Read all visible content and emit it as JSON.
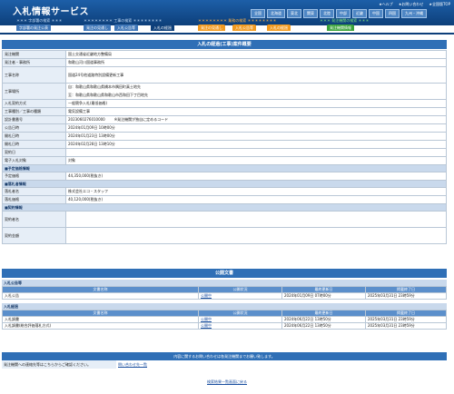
{
  "header": {
    "title": "入札情報サービス",
    "links": [
      "★ヘルプ",
      "★お問い合わせ",
      "★全国版TOP"
    ],
    "regions": [
      "全国",
      "北海道",
      "東北",
      "関東",
      "北陸",
      "中部",
      "近畿",
      "中国",
      "四国",
      "九州・沖縄"
    ]
  },
  "tab_groups": [
    "＊＊＊ 字部署の検索 ＊＊＊",
    "＊＊＊＊＊＊＊＊ 工事の検索 ＊＊＊＊＊＊＊＊",
    "＊＊＊＊＊＊＊＊ 業務の検索 ＊＊＊＊＊＊＊＊",
    "＊＊＊ 発注機関の検索 ＊＊＊"
  ],
  "tabs": [
    "字部署の発注公表",
    "発注の見通し",
    "入札公告等",
    "入札の経過",
    "発注の見通し",
    "入札公告等",
    "入札の経過",
    "発注機関情報"
  ],
  "section_title": "入札の経過(工事)案件概要",
  "details": [
    {
      "label": "発注機関",
      "value": "国土交通省近畿地方整備局"
    },
    {
      "label": "発注者・事務所",
      "value": "和歌山河川国道事務所"
    },
    {
      "label": "工事名称",
      "value": "国道24号他道路特別設備更新工事"
    },
    {
      "label": "工事場所",
      "value": "自：和歌山県和歌山県橋本市隅田町真土地先",
      "value2": "至：和歌山県和歌山県和歌山市西和田下丁目地先"
    },
    {
      "label": "入札契約方式",
      "value": "一般競争入札(最低価格)"
    },
    {
      "label": "工事種別／工事の種類",
      "value": "電気設備工事"
    },
    {
      "label": "設計書番号",
      "value": "2023060276010000",
      "note": "※発注機関が独自に定めるコード"
    },
    {
      "label": "公告日時",
      "value": "2024年01月09日 10時00分"
    },
    {
      "label": "開札日時",
      "value": "2024年01月23日 13時00分"
    },
    {
      "label": "開札日時",
      "value": "2024年02月28日 13時10分"
    },
    {
      "label": "契約日",
      "value": ""
    },
    {
      "label": "電子入札対象",
      "value": "対象"
    }
  ],
  "price_group": "■予定価格情報",
  "price": {
    "label": "予定価格",
    "value": "44,350,000(税抜き)"
  },
  "winner_group": "■落札者情報",
  "winner": [
    {
      "label": "落札者名",
      "value": "株式会社エコ・スタッフ"
    },
    {
      "label": "落札価格",
      "value": "40,120,000(税抜き)"
    }
  ],
  "contract_group": "■契約情報",
  "contract": [
    {
      "label": "契約者名",
      "value": ""
    },
    {
      "label": "契約金額",
      "value": ""
    }
  ],
  "public_docs": {
    "title": "公開文書",
    "sections": [
      {
        "name": "入札公告等",
        "columns": [
          "文書名称",
          "公開状況",
          "最終更新日",
          "掲載終了日"
        ],
        "rows": [
          [
            "入札公告",
            "公開中",
            "2024年01月09日 07時00分",
            "2025年03月31日 23時59分"
          ]
        ]
      },
      {
        "name": "入札経過",
        "columns": [
          "文書名称",
          "公開状況",
          "最終更新日",
          "掲載終了日"
        ],
        "rows": [
          [
            "入札調書",
            "公開中",
            "2024年06月22日 13時50分",
            "2025年03月31日 23時59分"
          ],
          [
            "入札調書(総合評価落札方式)",
            "公開中",
            "2024年06月22日 13時50分",
            "2025年03月31日 23時59分"
          ]
        ]
      }
    ]
  },
  "contact": {
    "title": "内容に関するお問い合わせは各発注機関までお願い致します。",
    "text": "発注機関への連絡先等はこちらからご確認ください。",
    "link": "問い合わせ先一覧"
  },
  "back_link": "検索結果一覧画面に戻る"
}
